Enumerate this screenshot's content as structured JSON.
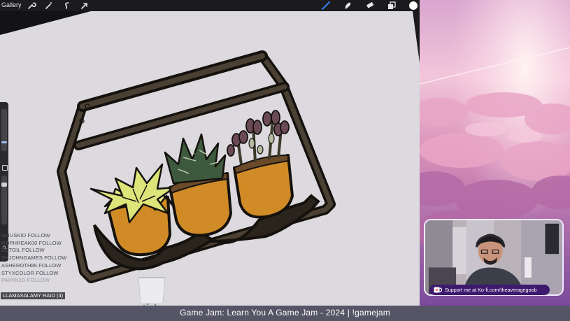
{
  "toolbar": {
    "gallery_label": "Gallery",
    "left_icons": [
      "wrench-icon",
      "magic-wand-icon",
      "selection-icon",
      "transform-arrow-icon"
    ],
    "right_icons": [
      "brush-icon",
      "smudge-icon",
      "eraser-icon",
      "layers-icon",
      "color-swatch-icon"
    ],
    "active_color": "#ffffff",
    "accent_color": "#3b82f6"
  },
  "follow_feed": [
    {
      "text": "AVIUSKID  FOLLOW",
      "faded": false
    },
    {
      "text": "ROPHREAK00  FOLLOW",
      "faded": false
    },
    {
      "text": "DETOIL  FOLLOW",
      "faded": false
    },
    {
      "text": "SHJOHNGAMES  FOLLOW",
      "faded": false
    },
    {
      "text": "ASHEROTH86  FOLLOW",
      "faded": false
    },
    {
      "text": "STYXCOLOR  FOLLOW",
      "faded": false
    },
    {
      "text": "PAIPIN3D  FOLLOW",
      "faded": true
    }
  ],
  "raid_alert": "LLAMASALAMY  RAID (4)",
  "kofi": {
    "label": "Support me at Ko-fi.com/theaveragegoob",
    "icon": "coffee-cup-icon"
  },
  "banner": {
    "title": "Game Jam: Learn You A Game Jam - 2024 | !gamejam"
  },
  "colors": {
    "canvas_bg": "#dcd9df",
    "pot": "#d08b26",
    "shelf_outline": "#1a1712",
    "shelf_fill": "#4a4033",
    "banner_bg": "#555566",
    "kofi_bg": "#3d1a6e"
  }
}
